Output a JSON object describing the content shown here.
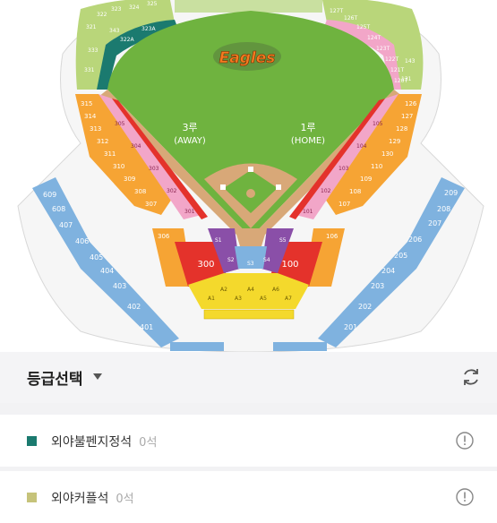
{
  "map": {
    "team_logo_text": "Eagles",
    "base_labels": {
      "third": "3루",
      "third_sub": "(AWAY)",
      "first": "1루",
      "first_sub": "(HOME)"
    },
    "sections": {
      "outfield_top_left": [
        "321",
        "322",
        "323",
        "324",
        "325",
        "331",
        "343",
        "333",
        "322A",
        "323A"
      ],
      "outfield_top_right": [
        "127T",
        "126T",
        "125T",
        "124T",
        "123T",
        "122T",
        "121T",
        "120T",
        "143",
        "131"
      ],
      "left_orange": [
        "315",
        "314",
        "313",
        "312",
        "311",
        "310",
        "309",
        "308",
        "307",
        "306"
      ],
      "left_pink": [
        "305",
        "304",
        "303",
        "302",
        "301"
      ],
      "right_orange": [
        "126",
        "127",
        "128",
        "129",
        "130",
        "110",
        "109",
        "108",
        "107",
        "106"
      ],
      "right_pink": [
        "105",
        "104",
        "103",
        "102",
        "101"
      ],
      "center_red_left": "300",
      "center_red_right": "100",
      "infield_purple": [
        "S1",
        "S2",
        "S3",
        "S4",
        "S5"
      ],
      "home_yellow": [
        "A1",
        "A2",
        "A3",
        "A4",
        "A5",
        "A6",
        "A7"
      ],
      "left_blue": [
        "609",
        "608",
        "407",
        "406",
        "405",
        "404",
        "403",
        "402",
        "401"
      ],
      "right_blue": [
        "209",
        "208",
        "207",
        "206",
        "205",
        "204",
        "203",
        "202",
        "201"
      ]
    }
  },
  "panel": {
    "title": "등급선택",
    "rows": [
      {
        "label": "외야불펜지정석",
        "count": "0석",
        "color": "#1b7a6f"
      },
      {
        "label": "외야커플석",
        "count": "0석",
        "color": "#c6c37a"
      }
    ]
  },
  "colors": {
    "grass": "#6fb33f",
    "dirt": "#d8a878",
    "orange": "#f6a434",
    "pink": "#f2a6c8",
    "red": "#e4322b",
    "purple": "#8a4fa8",
    "yellow": "#f4d92c",
    "blue": "#7fb2df",
    "teal": "#1b7a6f",
    "light_green": "#b9d67a"
  }
}
